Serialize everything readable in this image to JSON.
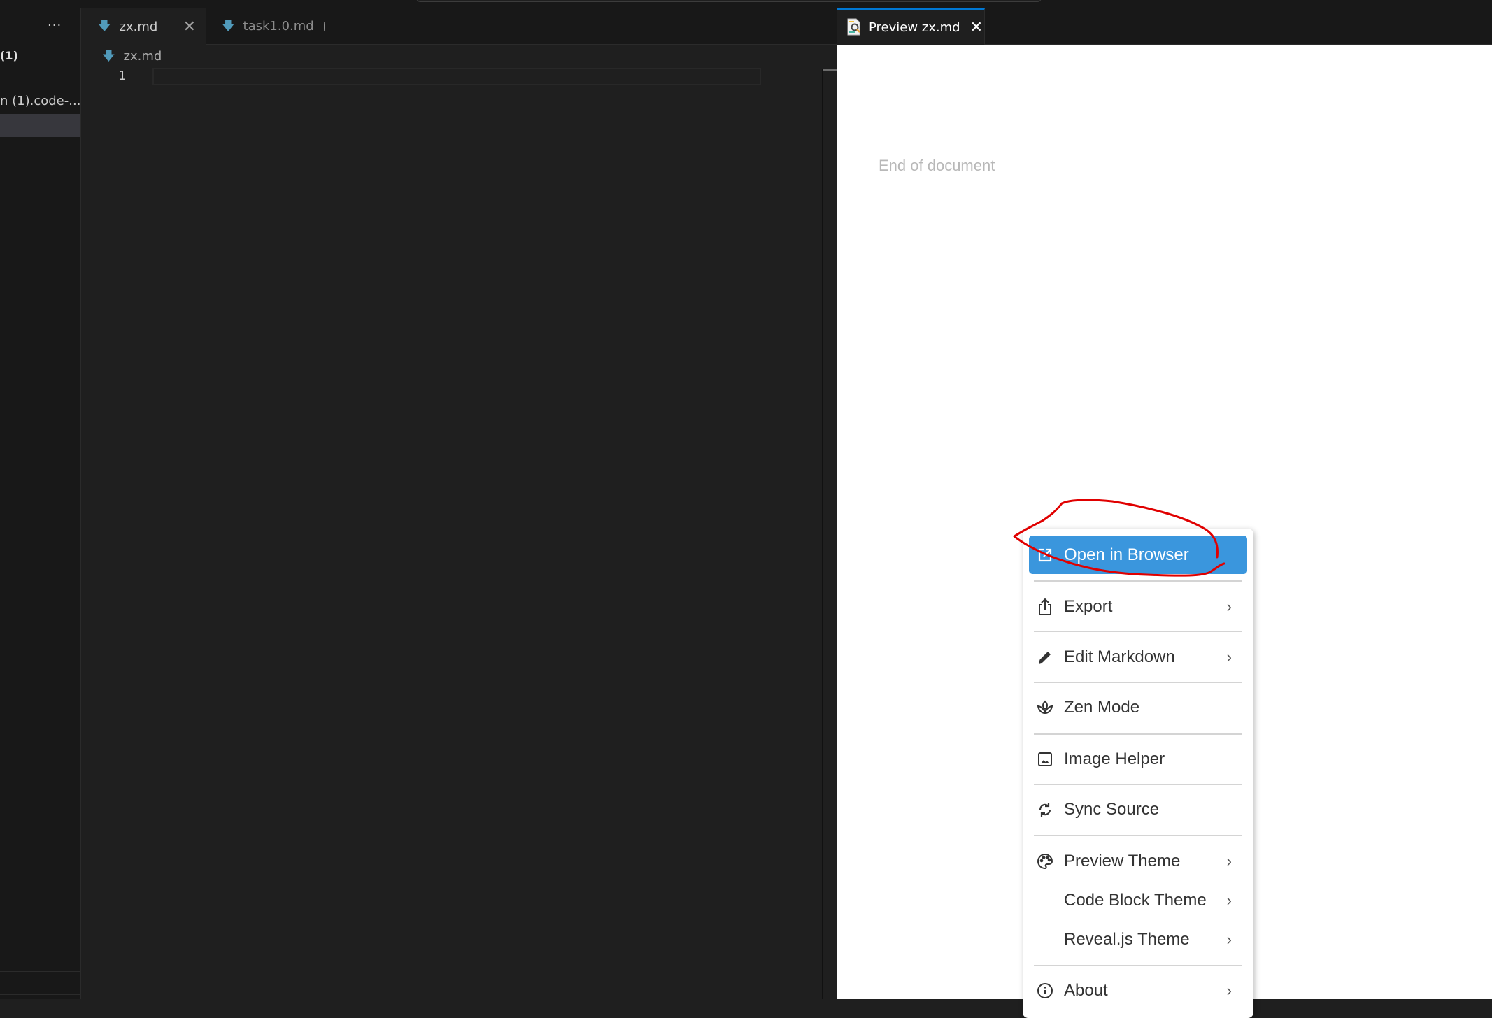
{
  "sidebar": {
    "more_label": "···",
    "section_title": "(1)",
    "workspace_item": "n (1).code-..."
  },
  "editor": {
    "tabs": [
      {
        "label": "zx.md",
        "icon": "markdown-arrow-icon",
        "active": true,
        "close_label": "✕"
      },
      {
        "label": "task1.0.md",
        "icon": "markdown-arrow-icon",
        "active": false,
        "dirty": true
      }
    ],
    "more_label": "···",
    "breadcrumb": {
      "file": "zx.md"
    },
    "line_numbers": [
      "1"
    ],
    "content": ""
  },
  "preview": {
    "tab": {
      "label": "Preview zx.md",
      "close_label": "✕"
    },
    "end_of_document": "End of document"
  },
  "context_menu": {
    "highlight_color": "#3a96dd",
    "items": [
      {
        "label": "Open in Browser",
        "icon": "external-link-icon",
        "submenu": false,
        "highlighted": true
      },
      {
        "label": "Export",
        "icon": "share-export-icon",
        "submenu": true
      },
      {
        "label": "Edit Markdown",
        "icon": "pencil-icon",
        "submenu": true
      },
      {
        "label": "Zen Mode",
        "icon": "lotus-icon",
        "submenu": false
      },
      {
        "label": "Image Helper",
        "icon": "image-icon",
        "submenu": false
      },
      {
        "label": "Sync Source",
        "icon": "sync-icon",
        "submenu": false
      },
      {
        "label": "Preview Theme",
        "icon": "palette-icon",
        "submenu": true
      },
      {
        "label": "Code Block Theme",
        "icon": "",
        "submenu": true
      },
      {
        "label": "Reveal.js Theme",
        "icon": "",
        "submenu": true
      },
      {
        "label": "About",
        "icon": "info-icon",
        "submenu": true
      }
    ],
    "chevron": "›"
  },
  "annotation": {
    "color": "#e00000",
    "target": "Open in Browser"
  }
}
